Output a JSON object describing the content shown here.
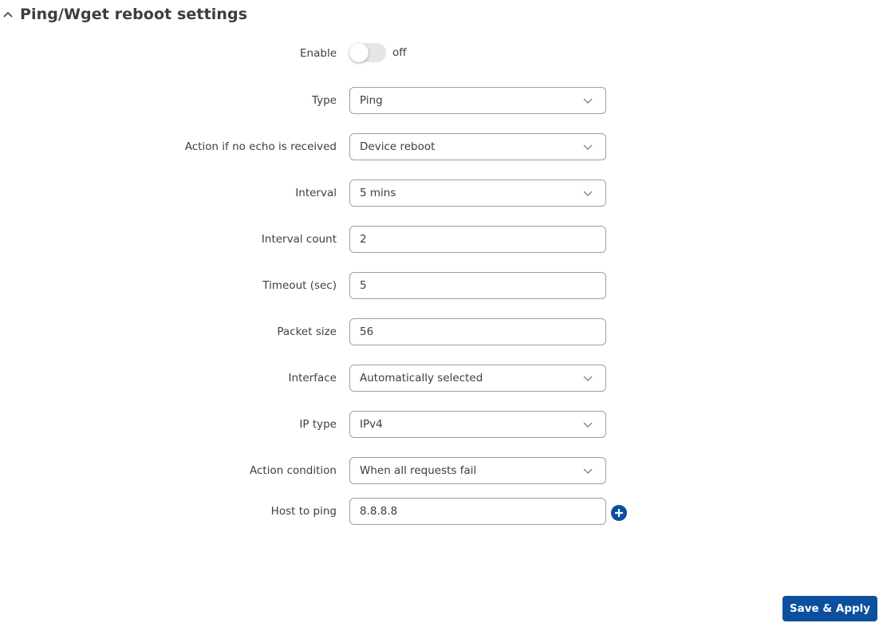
{
  "section": {
    "title": "Ping/Wget reboot settings",
    "collapse_icon": "chevron-up-icon"
  },
  "enable": {
    "label": "Enable",
    "state": "off",
    "state_label": "off"
  },
  "fields": {
    "type": {
      "label": "Type",
      "value": "Ping"
    },
    "action": {
      "label": "Action if no echo is received",
      "value": "Device reboot"
    },
    "interval": {
      "label": "Interval",
      "value": "5 mins"
    },
    "interval_count": {
      "label": "Interval count",
      "value": "2"
    },
    "timeout": {
      "label": "Timeout (sec)",
      "value": "5"
    },
    "packet_size": {
      "label": "Packet size",
      "value": "56"
    },
    "interface": {
      "label": "Interface",
      "value": "Automatically selected"
    },
    "ip_type": {
      "label": "IP type",
      "value": "IPv4"
    },
    "action_condition": {
      "label": "Action condition",
      "value": "When all requests fail"
    },
    "host": {
      "label": "Host to ping",
      "value": "8.8.8.8",
      "add_icon": "plus-circle-icon"
    }
  },
  "footer": {
    "save_label": "Save & Apply"
  },
  "colors": {
    "accent": "#0b4f9e",
    "toggle_off": "#e6e6e6",
    "border": "#9e9e9e"
  }
}
